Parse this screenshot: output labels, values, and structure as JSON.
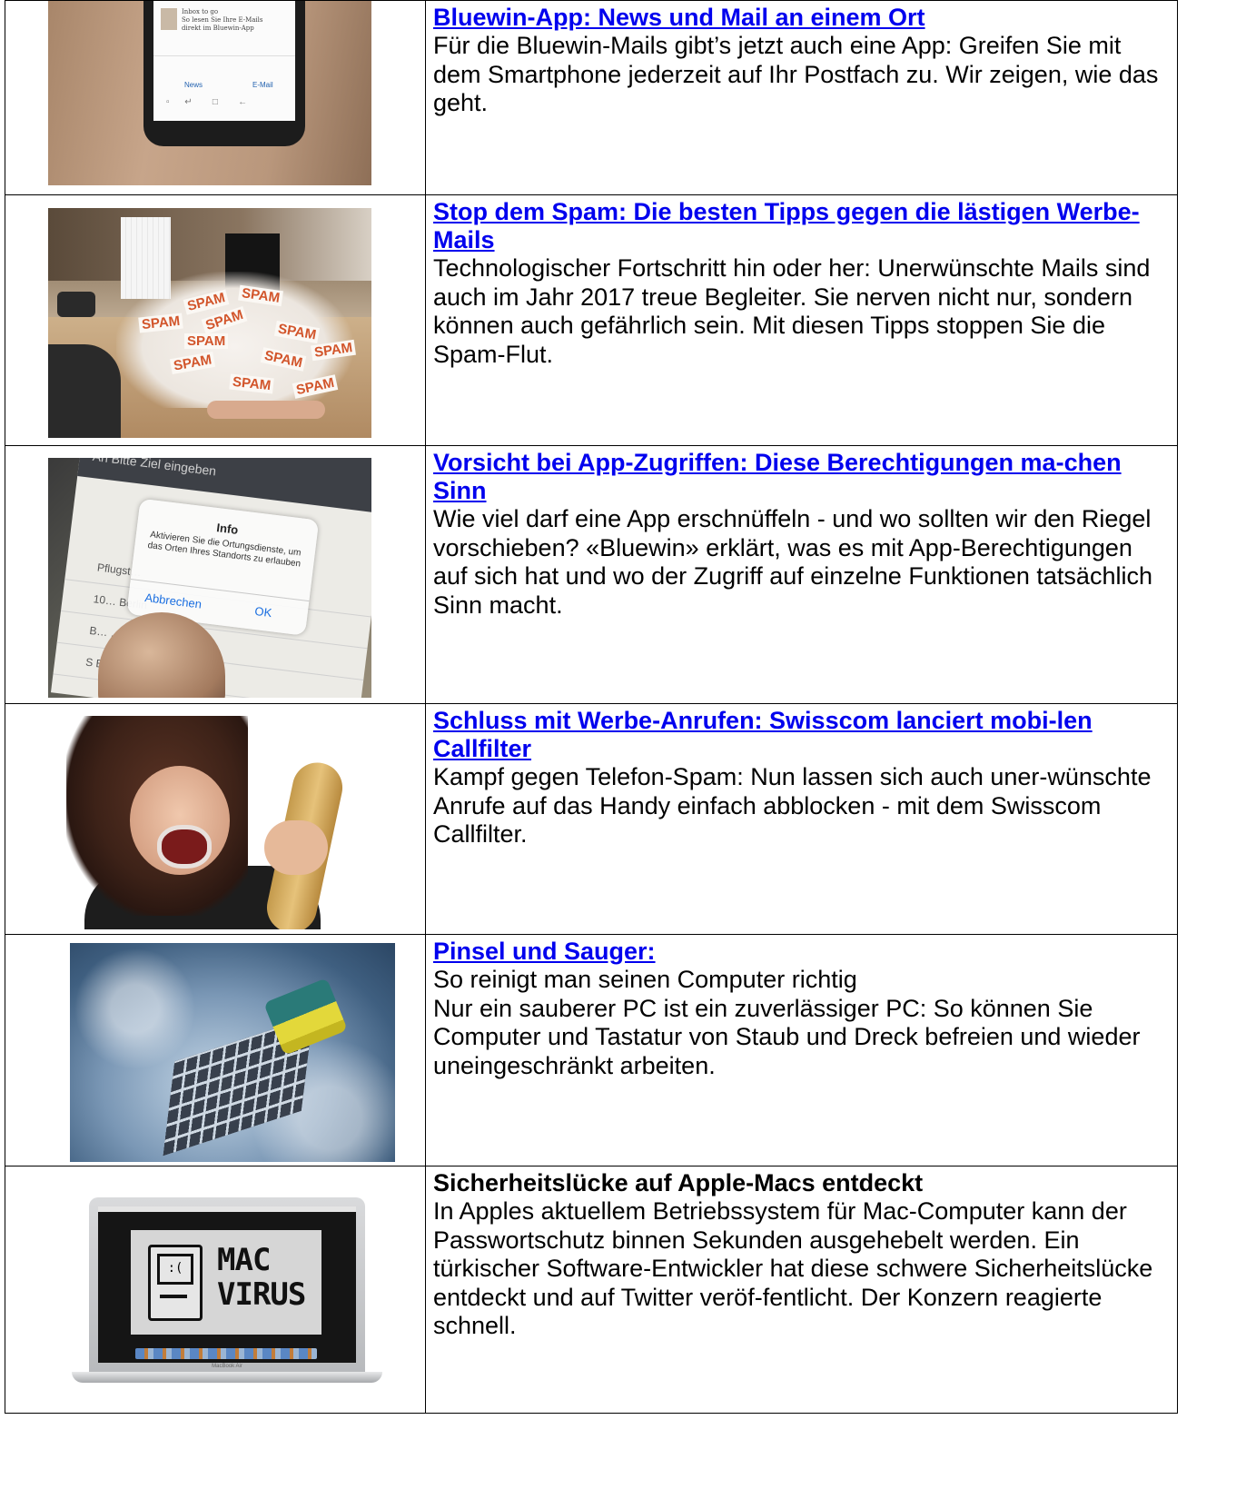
{
  "articles": [
    {
      "title": "Bluewin-App: News und Mail an einem Ort",
      "title_linked": true,
      "body": [
        "Für die Bluewin-Mails gibt’s jetzt auch eine App: Greifen Sie mit dem Smartphone jederzeit auf Ihr Postfach zu. Wir zeigen, wie das geht."
      ],
      "image": {
        "screen_text": [
          "Inbox to go",
          "So lesen Sie Ihre E-Mails",
          "direkt im Bluewin-App"
        ],
        "tabs": [
          "News",
          "E-Mail"
        ],
        "nav_keys": [
          "▫",
          "↵",
          "□",
          "←"
        ]
      }
    },
    {
      "title": "Stop dem Spam: Die besten Tipps gegen die lästigen Werbe-Mails",
      "title_linked": true,
      "body": [
        "Technologischer Fortschritt hin oder her: Unerwünschte Mails sind auch im Jahr 2017 treue Begleiter. Sie nerven nicht nur, sondern können auch gefährlich sein. Mit diesen Tipps stoppen Sie die Spam-Flut."
      ],
      "image": {
        "label": "SPAM"
      }
    },
    {
      "title": "Vorsicht bei App-Zugriffen: Diese Berechtigungen ma-chen Sinn",
      "title_linked": true,
      "body": [
        "Wie viel darf eine App erschnüffeln - und wo sollten wir den Riegel vorschieben? «Bluewin» erklärt, was es mit App-Berechtigungen auf sich hat und wo der Zugriff auf einzelne Funktionen tatsächlich Sinn macht."
      ],
      "image": {
        "header_text": "An  Bitte Ziel eingeben",
        "dialog_title": "Info",
        "dialog_message": "Aktivieren Sie die Ortungsdienste, um das Orten Ihres Standorts zu erlauben",
        "cancel_label": "Abbrechen",
        "ok_label": "OK",
        "rows": [
          "Pflugst…",
          "10…  Berlin",
          "B…  …rg,",
          "S B…"
        ]
      }
    },
    {
      "title": "Schluss mit Werbe-Anrufen: Swisscom lanciert mobi-len Callfilter",
      "title_linked": true,
      "body": [
        "Kampf gegen Telefon-Spam: Nun lassen sich auch uner-wünschte Anrufe auf das Handy einfach abblocken - mit dem Swisscom Callfilter."
      ],
      "image": {}
    },
    {
      "title": "Pinsel und Sauger:",
      "title_linked": true,
      "body": [
        "So reinigt man seinen Computer richtig",
        "Nur ein sauberer PC ist ein zuverlässiger PC: So können Sie Computer und Tastatur von Staub und Dreck befreien und wieder uneingeschränkt arbeiten."
      ],
      "image": {}
    },
    {
      "title": "Sicherheitslücke auf Apple-Macs entdeckt",
      "title_linked": false,
      "body": [
        "In Apples aktuellem Betriebssystem für Mac-Computer kann der Passwortschutz binnen Sekunden ausgehebelt werden. Ein türkischer Software-Entwickler hat diese schwere Sicherheitslücke entdeckt und auf Twitter veröf-fentlicht. Der Konzern reagierte schnell."
      ],
      "image": {
        "screen_line1": "MAC",
        "screen_line2": "VIRUS",
        "face": ":(",
        "brand": "MacBook Air"
      }
    }
  ],
  "colors": {
    "link": "#0000ee",
    "border": "#000000",
    "text": "#000000"
  }
}
